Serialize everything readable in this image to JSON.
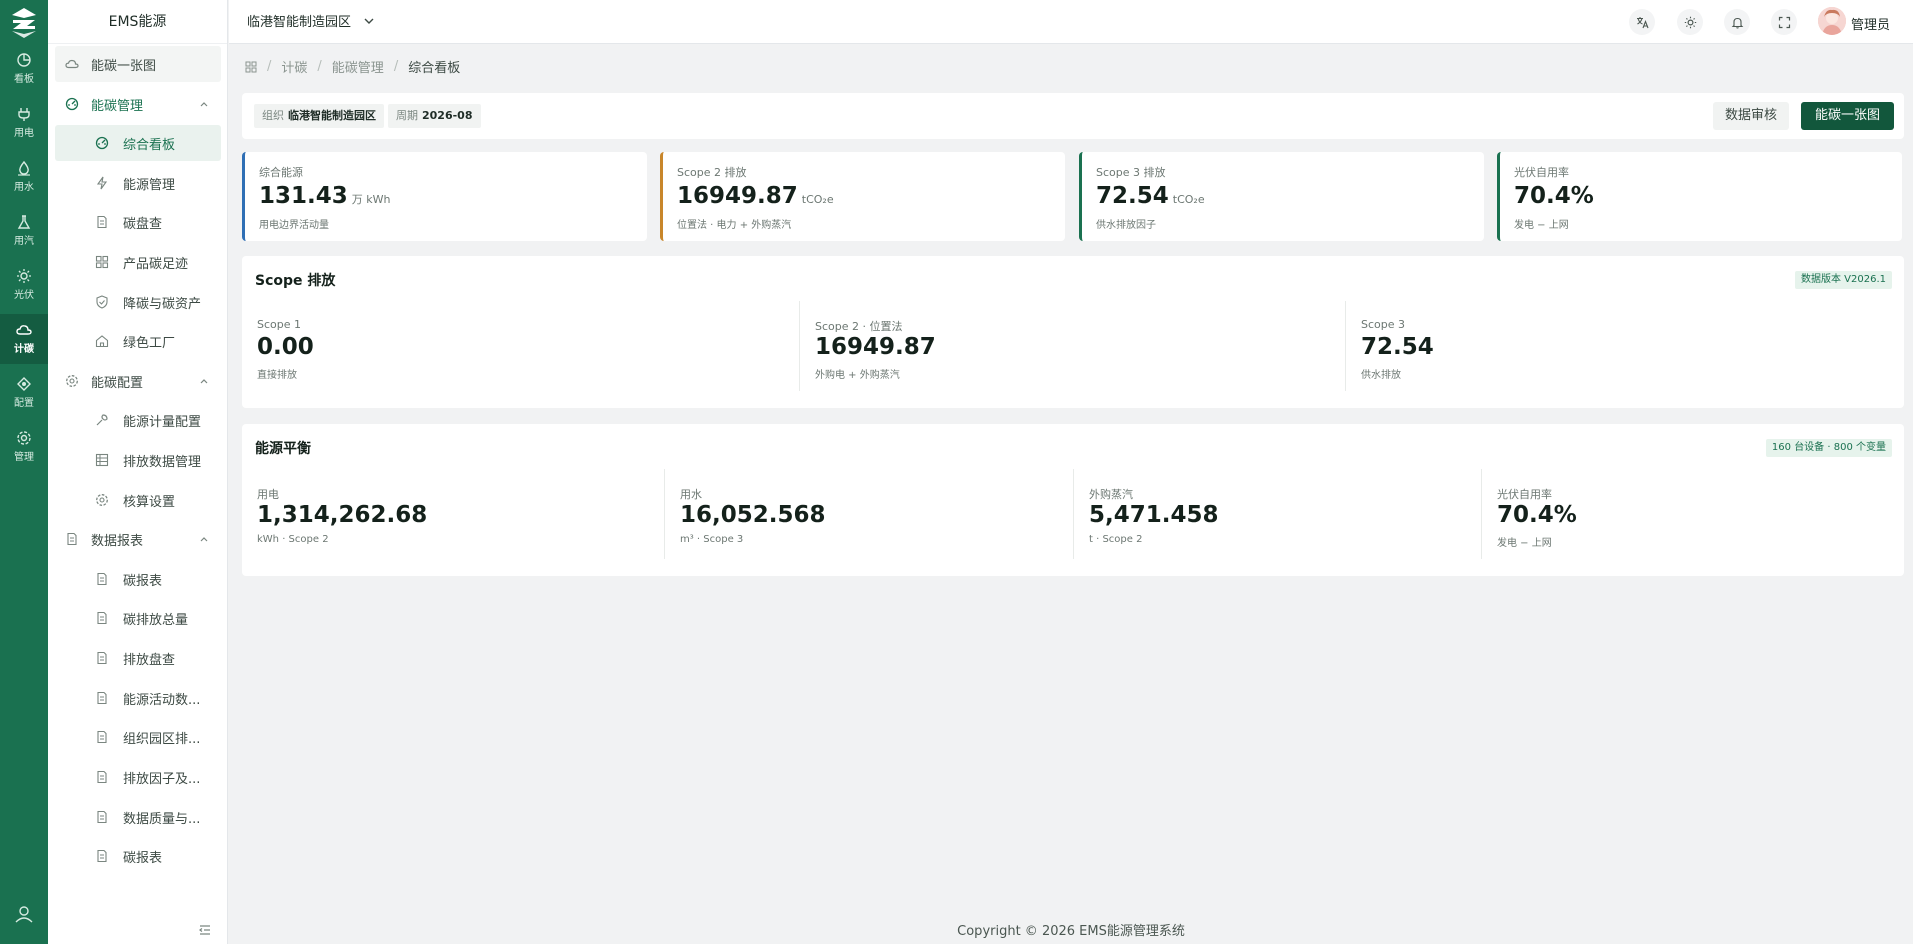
{
  "rail": {
    "items": [
      {
        "label": "看板",
        "icon": "pie-chart-icon"
      },
      {
        "label": "用电",
        "icon": "plug-icon"
      },
      {
        "label": "用水",
        "icon": "water-drop-icon"
      },
      {
        "label": "用汽",
        "icon": "flask-icon"
      },
      {
        "label": "光伏",
        "icon": "sun-icon"
      },
      {
        "label": "计碳",
        "icon": "cloud-icon",
        "active": true
      },
      {
        "label": "配置",
        "icon": "settings-sliders-icon"
      },
      {
        "label": "管理",
        "icon": "gear-icon"
      }
    ]
  },
  "sidebar": {
    "brand": "EMS能源",
    "items": [
      {
        "label": "能碳一张图"
      },
      {
        "label": "能碳管理"
      },
      {
        "label": "综合看板"
      },
      {
        "label": "能源管理"
      },
      {
        "label": "碳盘查"
      },
      {
        "label": "产品碳足迹"
      },
      {
        "label": "降碳与碳资产"
      },
      {
        "label": "绿色工厂"
      },
      {
        "label": "能碳配置"
      },
      {
        "label": "能源计量配置"
      },
      {
        "label": "排放数据管理"
      },
      {
        "label": "核算设置"
      },
      {
        "label": "数据报表"
      },
      {
        "label": "碳报表"
      },
      {
        "label": "碳排放总量"
      },
      {
        "label": "排放盘查"
      },
      {
        "label": "能源活动数..."
      },
      {
        "label": "组织园区排..."
      },
      {
        "label": "排放因子及..."
      },
      {
        "label": "数据质量与..."
      },
      {
        "label": "碳报表"
      }
    ]
  },
  "header": {
    "park": "临港智能制造园区",
    "user": "管理员"
  },
  "breadcrumb": [
    "计碳",
    "能碳管理",
    "综合看板"
  ],
  "toolbar": {
    "org_label": "组织",
    "org_value": "临港智能制造园区",
    "period_label": "周期",
    "period_value": "2026-08",
    "review_btn": "数据审核",
    "map_btn": "能碳一张图"
  },
  "kpis": [
    {
      "label": "综合能源",
      "value": "131.43",
      "unit": "万 kWh",
      "sub": "用电边界活动量",
      "color": "#2f6fb5"
    },
    {
      "label": "Scope 2 排放",
      "value": "16949.87",
      "unit": "tCO₂e",
      "sub": "位置法 · 电力 + 外购蒸汽",
      "color": "#c8862a"
    },
    {
      "label": "Scope 3 排放",
      "value": "72.54",
      "unit": "tCO₂e",
      "sub": "供水排放因子",
      "color": "#1a7150"
    },
    {
      "label": "光伏自用率",
      "value": "70.4%",
      "unit": "",
      "sub": "发电 − 上网",
      "color": "#1a7150"
    }
  ],
  "scope": {
    "title": "Scope 排放",
    "badge": "数据版本 V2026.1",
    "metrics": [
      {
        "label": "Scope 1",
        "value": "0.00",
        "sub": "直接排放"
      },
      {
        "label": "Scope 2 · 位置法",
        "value": "16949.87",
        "sub": "外购电 + 外购蒸汽"
      },
      {
        "label": "Scope 3",
        "value": "72.54",
        "sub": "供水排放"
      }
    ]
  },
  "balance": {
    "title": "能源平衡",
    "badge": "160 台设备 · 800 个变量",
    "metrics": [
      {
        "label": "用电",
        "value": "1,314,262.68",
        "sub": "kWh · Scope 2"
      },
      {
        "label": "用水",
        "value": "16,052.568",
        "sub": "m³ · Scope 3"
      },
      {
        "label": "外购蒸汽",
        "value": "5,471.458",
        "sub": "t · Scope 2"
      },
      {
        "label": "光伏自用率",
        "value": "70.4%",
        "sub": "发电 − 上网"
      }
    ]
  },
  "footer": "Copyright © 2026 EMS能源管理系统"
}
